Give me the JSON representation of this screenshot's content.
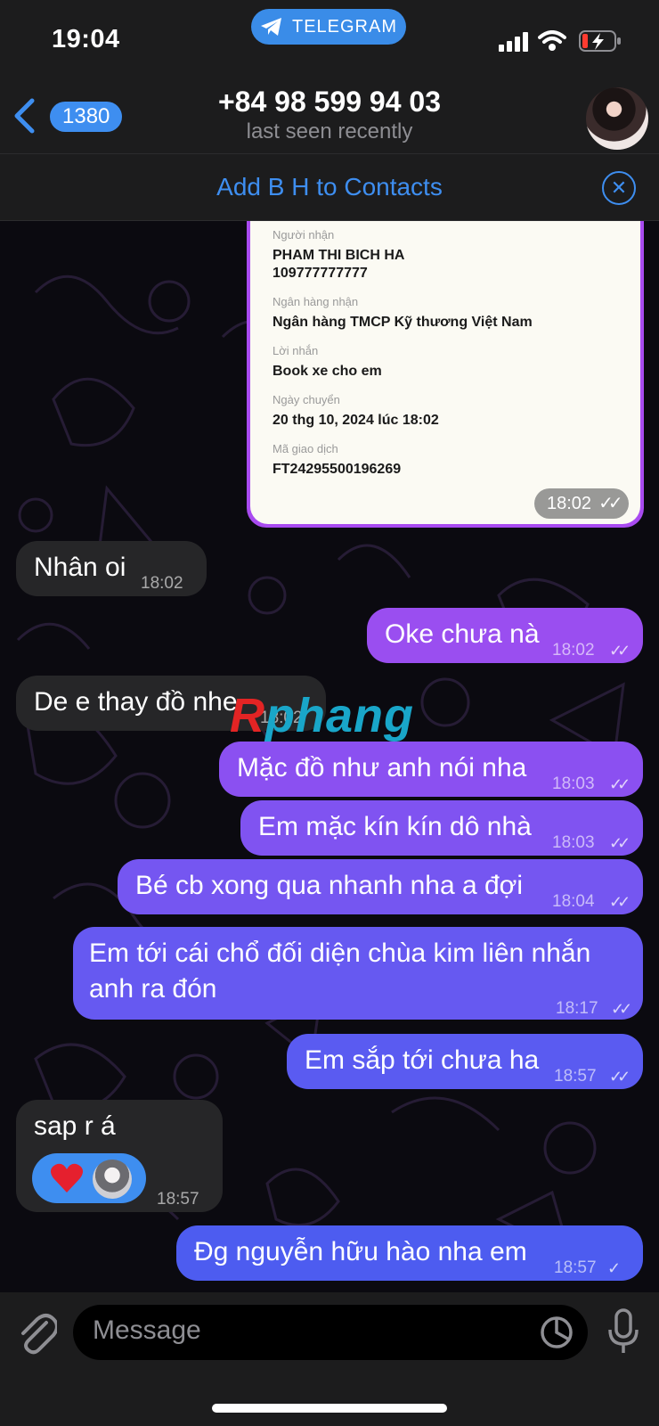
{
  "status_bar": {
    "time": "19:04"
  },
  "app_pill": {
    "label": "TELEGRAM"
  },
  "header": {
    "back_count": "1380",
    "contact_title": "+84 98 599 94 03",
    "contact_status": "last seen recently"
  },
  "contact_bar": {
    "add_label": "Add B H to Contacts"
  },
  "receipt": {
    "recipient_label": "Người nhận",
    "recipient_name": "PHAM THI BICH HA",
    "recipient_account": "109777777777",
    "bank_label": "Ngân hàng nhận",
    "bank_name": "Ngân hàng TMCP Kỹ thương Việt Nam",
    "memo_label": "Lời nhắn",
    "memo": "Book xe cho em",
    "date_label": "Ngày chuyển",
    "date": "20 thg 10, 2024 lúc 18:02",
    "txn_label": "Mã giao dịch",
    "txn_id": "FT24295500196269",
    "time": "18:02"
  },
  "messages": [
    {
      "id": "m1",
      "dir": "in",
      "text": "Nhân oi",
      "time": "18:02"
    },
    {
      "id": "m2",
      "dir": "out",
      "text": "Oke chưa nà",
      "time": "18:02"
    },
    {
      "id": "m3",
      "dir": "in",
      "text": "De e thay đồ nhe",
      "time": "18:02"
    },
    {
      "id": "m4",
      "dir": "out",
      "text": "Mặc đồ như anh nói nha",
      "time": "18:03"
    },
    {
      "id": "m5",
      "dir": "out",
      "text": "Em mặc kín kín dô nhà",
      "time": "18:03"
    },
    {
      "id": "m6",
      "dir": "out",
      "text": "Bé cb xong qua nhanh nha a đợi",
      "time": "18:04"
    },
    {
      "id": "m7",
      "dir": "out",
      "text_line1": "Em tới cái chổ đối diện chùa kim liên nhắn",
      "text_line2": "anh ra đón",
      "time": "18:17"
    },
    {
      "id": "m8",
      "dir": "out",
      "text": "Em sắp tới chưa ha",
      "time": "18:57"
    },
    {
      "id": "m9",
      "dir": "in",
      "text": "sap r á",
      "time": "18:57",
      "reaction": "heart"
    },
    {
      "id": "m10",
      "dir": "out",
      "text": "Đg nguyễn hữu hào nha em",
      "time": "18:57"
    }
  ],
  "watermark": {
    "part1": "R",
    "part2": "phang"
  },
  "composer": {
    "placeholder": "Message"
  },
  "colors": {
    "accent": "#3e8ef0",
    "incoming": "#262628",
    "outgoing_top": "#a94bf0",
    "outgoing_bottom": "#4d5cf0"
  },
  "icons": [
    "telegram-icon",
    "signal-icon",
    "wifi-icon",
    "battery-icon",
    "back-chevron-icon",
    "close-circle-icon",
    "attach-icon",
    "sticker-icon",
    "microphone-icon",
    "double-check-icon",
    "single-check-icon",
    "heart-icon"
  ]
}
